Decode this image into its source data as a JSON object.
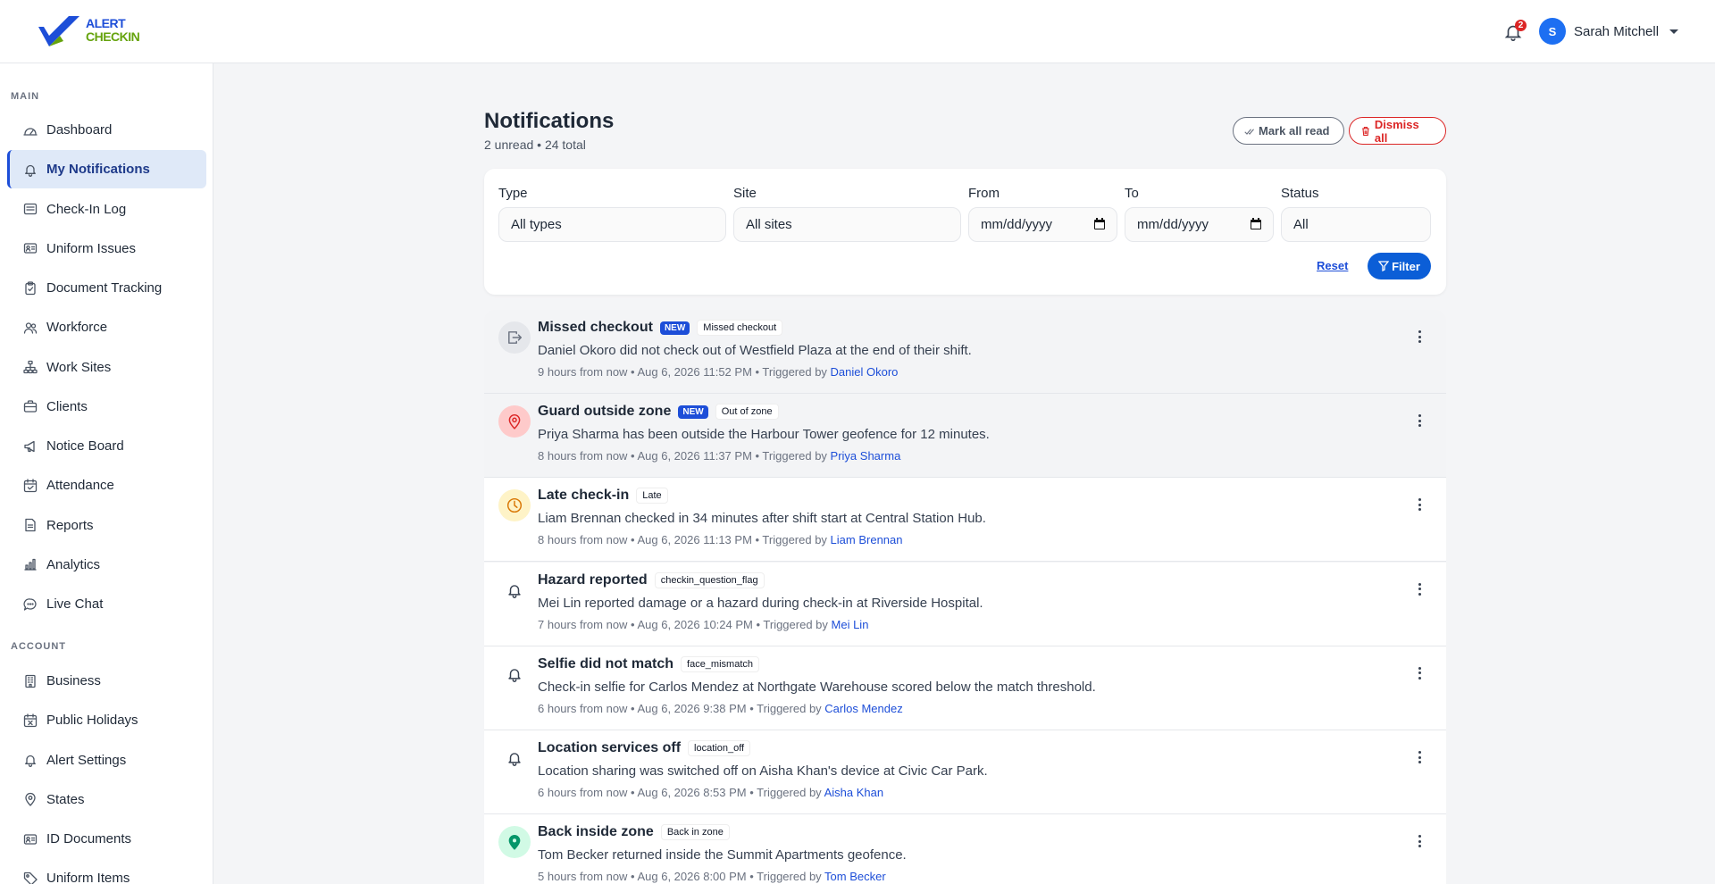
{
  "brand": {
    "line1": "ALERT",
    "line2": "CHECKIN",
    "blue": "#1d4ed8",
    "green": "#65a30d"
  },
  "header": {
    "notification_count": "2",
    "user_initial": "S",
    "user_name": "Sarah Mitchell"
  },
  "sidebar": {
    "main_label": "MAIN",
    "account_label": "ACCOUNT",
    "main_items": [
      {
        "label": "Dashboard",
        "icon": "dashboard-icon"
      },
      {
        "label": "My Notifications",
        "icon": "bell-icon",
        "active": true
      },
      {
        "label": "Check-In Log",
        "icon": "list-icon"
      },
      {
        "label": "Uniform Issues",
        "icon": "id-card-icon"
      },
      {
        "label": "Document Tracking",
        "icon": "clipboard-icon"
      },
      {
        "label": "Workforce",
        "icon": "people-icon"
      },
      {
        "label": "Work Sites",
        "icon": "sitemap-icon"
      },
      {
        "label": "Clients",
        "icon": "briefcase-icon"
      },
      {
        "label": "Notice Board",
        "icon": "megaphone-icon"
      },
      {
        "label": "Attendance",
        "icon": "calendar-check-icon"
      },
      {
        "label": "Reports",
        "icon": "report-icon"
      },
      {
        "label": "Analytics",
        "icon": "bar-chart-icon"
      },
      {
        "label": "Live Chat",
        "icon": "chat-icon"
      }
    ],
    "account_items": [
      {
        "label": "Business",
        "icon": "building-icon"
      },
      {
        "label": "Public Holidays",
        "icon": "calendar-x-icon"
      },
      {
        "label": "Alert Settings",
        "icon": "bell-icon"
      },
      {
        "label": "States",
        "icon": "map-pin-icon"
      },
      {
        "label": "ID Documents",
        "icon": "id-card-icon"
      },
      {
        "label": "Uniform Items",
        "icon": "tag-icon"
      }
    ]
  },
  "page": {
    "title": "Notifications",
    "subtitle": "2 unread • 24 total",
    "mark_all_read": "Mark all read",
    "dismiss_all": "Dismiss all"
  },
  "filters": {
    "type_label": "Type",
    "type_value": "All types",
    "site_label": "Site",
    "site_value": "All sites",
    "from_label": "From",
    "from_value": "mm/dd/yyyy",
    "to_label": "To",
    "to_value": "mm/dd/yyyy",
    "status_label": "Status",
    "status_value": "All",
    "reset": "Reset",
    "filter": "Filter"
  },
  "notifications": [
    {
      "title": "Missed checkout",
      "is_new": true,
      "new_label": "NEW",
      "type": "Missed checkout",
      "desc": "Daniel Okoro did not check out of Westfield Plaza at the end of their shift.",
      "meta": "9 hours from now • Aug 6, 2026 11:52 PM • Triggered by ",
      "who": "Daniel Okoro",
      "icon": "exit-icon",
      "icon_bg": "#e5e7eb",
      "icon_color": "#6b7280"
    },
    {
      "title": "Guard outside zone",
      "is_new": true,
      "new_label": "NEW",
      "type": "Out of zone",
      "desc": "Priya Sharma has been outside the Harbour Tower geofence for 12 minutes.",
      "meta": "8 hours from now • Aug 6, 2026 11:37 PM • Triggered by ",
      "who": "Priya Sharma",
      "icon": "map-pin-icon",
      "icon_bg": "#fecaca",
      "icon_color": "#dc2626"
    },
    {
      "title": "Late check-in",
      "is_new": false,
      "type": "Late",
      "desc": "Liam Brennan checked in 34 minutes after shift start at Central Station Hub.",
      "meta": "8 hours from now • Aug 6, 2026 11:13 PM • Triggered by ",
      "who": "Liam Brennan",
      "icon": "clock-icon",
      "icon_bg": "#fef3c7",
      "icon_color": "#d97706"
    },
    {
      "title": "Hazard reported",
      "is_new": false,
      "type": "checkin_question_flag",
      "desc": "Mei Lin reported damage or a hazard during check-in at Riverside Hospital.",
      "meta": "7 hours from now • Aug 6, 2026 10:24 PM • Triggered by ",
      "who": "Mei Lin",
      "icon": "bell-icon",
      "icon_bg": "transparent",
      "icon_color": "#374151"
    },
    {
      "title": "Selfie did not match",
      "is_new": false,
      "type": "face_mismatch",
      "desc": "Check-in selfie for Carlos Mendez at Northgate Warehouse scored below the match threshold.",
      "meta": "6 hours from now • Aug 6, 2026 9:38 PM • Triggered by ",
      "who": "Carlos Mendez",
      "icon": "bell-icon",
      "icon_bg": "transparent",
      "icon_color": "#374151"
    },
    {
      "title": "Location services off",
      "is_new": false,
      "type": "location_off",
      "desc": "Location sharing was switched off on Aisha Khan's device at Civic Car Park.",
      "meta": "6 hours from now • Aug 6, 2026 8:53 PM • Triggered by ",
      "who": "Aisha Khan",
      "icon": "bell-icon",
      "icon_bg": "transparent",
      "icon_color": "#374151"
    },
    {
      "title": "Back inside zone",
      "is_new": false,
      "type": "Back in zone",
      "desc": "Tom Becker returned inside the Summit Apartments geofence.",
      "meta": "5 hours from now • Aug 6, 2026 8:00 PM • Triggered by ",
      "who": "Tom Becker",
      "icon": "map-pin-filled-icon",
      "icon_bg": "#d1fae5",
      "icon_color": "#059669"
    }
  ]
}
